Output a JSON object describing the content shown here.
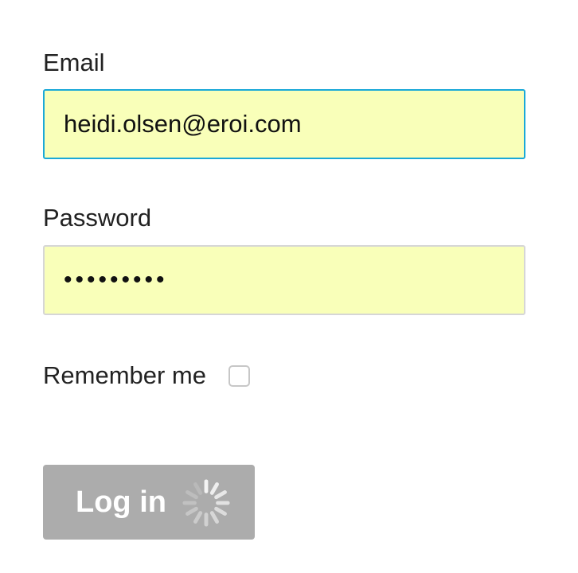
{
  "form": {
    "email_label": "Email",
    "email_value": "heidi.olsen@eroi.com",
    "password_label": "Password",
    "password_mask": "•••••••••",
    "remember_label": "Remember me",
    "remember_checked": false,
    "login_label": "Log in",
    "login_state": "loading"
  },
  "colors": {
    "autofill_background": "#f9ffb9",
    "focus_border": "#1aa9d8",
    "disabled_button": "#acacac"
  },
  "icons": {
    "spinner": "loading-spinner-icon"
  }
}
